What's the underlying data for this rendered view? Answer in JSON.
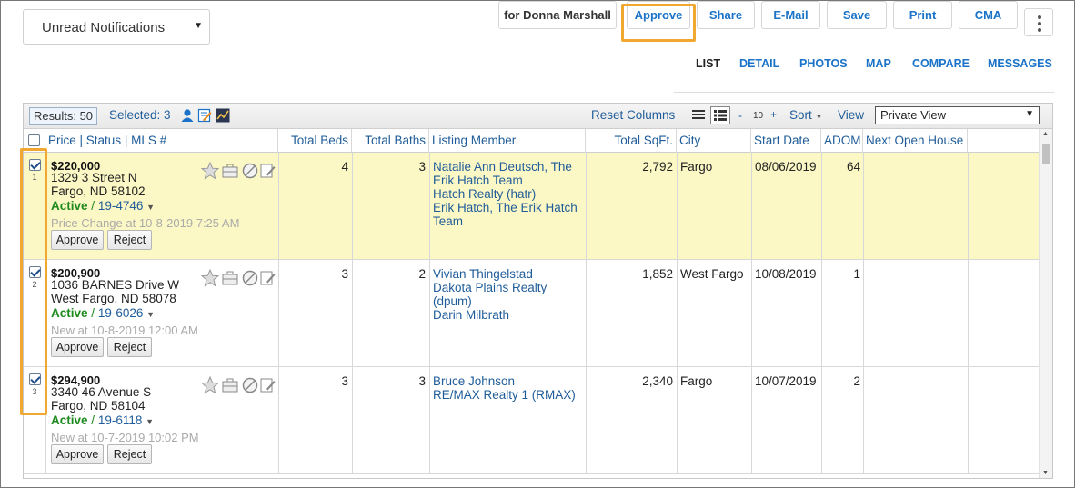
{
  "notifications_select": {
    "value": "Unread Notifications"
  },
  "top_buttons": {
    "user": "for Donna Marshall",
    "approve": "Approve",
    "share": "Share",
    "email": "E-Mail",
    "save": "Save",
    "print": "Print",
    "cma": "CMA"
  },
  "tabs": [
    "LIST",
    "DETAIL",
    "PHOTOS",
    "MAP",
    "COMPARE",
    "MESSAGES"
  ],
  "active_tab": "LIST",
  "toolbar": {
    "results": "Results: 50",
    "selected": "Selected: 3",
    "reset_columns": "Reset Columns",
    "per_page_minus": "-",
    "per_page": "10",
    "per_page_plus": "+",
    "sort": "Sort",
    "view_label": "View",
    "view_value": "Private View"
  },
  "columns": {
    "price": "Price",
    "status": "Status",
    "mls": "MLS #",
    "beds": "Total Beds",
    "baths": "Total Baths",
    "member": "Listing Member",
    "sqft": "Total SqFt.",
    "city": "City",
    "start": "Start Date",
    "adom": "ADOM",
    "open_house": "Next Open House"
  },
  "colors": {
    "accent": "#1a73c8",
    "highlight": "#f0a830",
    "selected_row": "#fcf8c5",
    "active": "#1e8a1e"
  },
  "rows": [
    {
      "num": "1",
      "checked": true,
      "selected": true,
      "price": "$220,000",
      "addr1": "1329 3 Street N",
      "addr2": "Fargo, ND 58102",
      "status": "Active",
      "mls": "19-4746",
      "note": "Price Change at 10-8-2019 7:25 AM",
      "approve": "Approve",
      "reject": "Reject",
      "beds": "4",
      "baths": "3",
      "member": [
        "Natalie Ann Deutsch, The",
        "Erik Hatch Team",
        "Hatch Realty (hatr)",
        "Erik Hatch, The Erik Hatch",
        "Team"
      ],
      "sqft": "2,792",
      "city": "Fargo",
      "start": "08/06/2019",
      "adom": "64"
    },
    {
      "num": "2",
      "checked": true,
      "selected": false,
      "price": "$200,900",
      "addr1": "1036 BARNES Drive W",
      "addr2": "West Fargo, ND 58078",
      "status": "Active",
      "mls": "19-6026",
      "note": "New at 10-8-2019 12:00 AM",
      "approve": "Approve",
      "reject": "Reject",
      "beds": "3",
      "baths": "2",
      "member": [
        "Vivian Thingelstad",
        "Dakota Plains Realty",
        "(dpum)",
        "Darin Milbrath"
      ],
      "sqft": "1,852",
      "city": "West Fargo",
      "start": "10/08/2019",
      "adom": "1"
    },
    {
      "num": "3",
      "checked": true,
      "selected": false,
      "price": "$294,900",
      "addr1": "3340 46 Avenue S",
      "addr2": "Fargo, ND 58104",
      "status": "Active",
      "mls": "19-6118",
      "note": "New at 10-7-2019 10:02 PM",
      "approve": "Approve",
      "reject": "Reject",
      "beds": "3",
      "baths": "3",
      "member": [
        "Bruce Johnson",
        "RE/MAX Realty 1 (RMAX)"
      ],
      "sqft": "2,340",
      "city": "Fargo",
      "start": "10/07/2019",
      "adom": "2"
    }
  ]
}
